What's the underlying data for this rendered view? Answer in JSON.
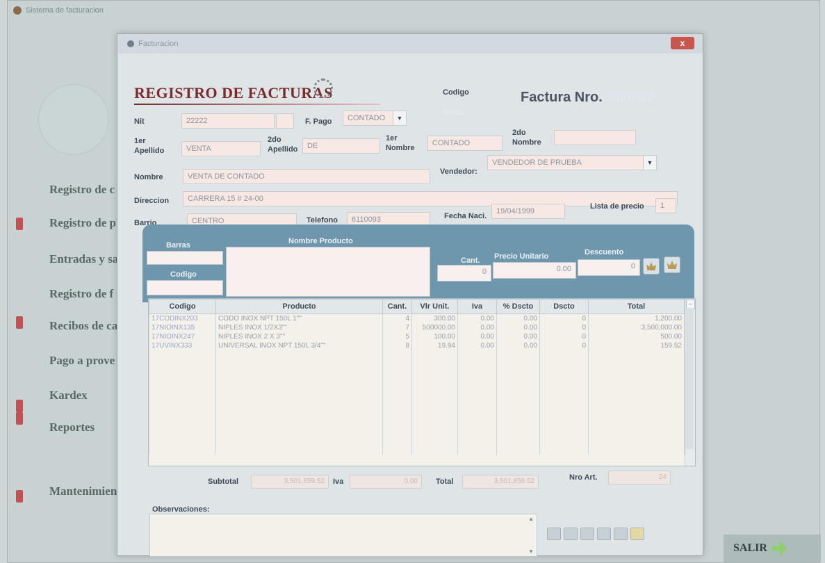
{
  "app": {
    "title": "Sistema de facturacion"
  },
  "menu": [
    {
      "label": "Registro de c"
    },
    {
      "label": "Registro de p"
    },
    {
      "label": "Entradas y sa"
    },
    {
      "label": "Registro de f"
    },
    {
      "label": "Recibos de ca"
    },
    {
      "label": "Pago a prove"
    },
    {
      "label": "Kardex"
    },
    {
      "label": "Reportes"
    },
    {
      "label": "Mantenimien"
    }
  ],
  "salir": {
    "label": "SALIR"
  },
  "dialog": {
    "title": "Facturacion",
    "close_label": "x",
    "header_title": "REGISTRO DE FACTURAS",
    "codigo_label": "Codigo",
    "codigo_value": "000002",
    "factura_label": "Factura Nro.",
    "factura_number": "000002"
  },
  "form": {
    "nit": {
      "label": "Nit",
      "value": "22222"
    },
    "fpago": {
      "label": "F. Pago",
      "value": "CONTADO"
    },
    "ape1": {
      "label1": "1er",
      "label2": "Apellido",
      "value": "VENTA"
    },
    "ape2": {
      "label1": "2do",
      "label2": "Apellido",
      "value": "DE"
    },
    "nom1": {
      "label1": "1er",
      "label2": "Nombre",
      "value": "CONTADO"
    },
    "nom2": {
      "label1": "2do",
      "label2": "Nombre",
      "value": ""
    },
    "nombre": {
      "label": "Nombre",
      "value": "VENTA DE CONTADO"
    },
    "vendedor": {
      "label": "Vendedor:",
      "value": "VENDEDOR DE PRUEBA"
    },
    "direccion": {
      "label": "Direccion",
      "value": "CARRERA 15 # 24-00"
    },
    "barrio": {
      "label": "Barrio",
      "value": "CENTRO"
    },
    "telefono": {
      "label": "Telefono",
      "value": "6110093"
    },
    "fecha": {
      "label": "Fecha Naci.",
      "value": "19/04/1999"
    },
    "lista": {
      "label": "Lista de precio",
      "value": "1"
    }
  },
  "entry": {
    "barras_label": "Barras",
    "codigo_label": "Codigo",
    "nombre_label": "Nombre Producto",
    "cant_label": "Cant.",
    "cant_value": "0",
    "precio_label": "Precio Unitario",
    "precio_value": "0.00",
    "desc_label": "Descuento",
    "desc_value": "0"
  },
  "table": {
    "headers": [
      "Codigo",
      "Producto",
      "Cant.",
      "Vlr Unit.",
      "Iva",
      "% Dscto",
      "Dscto",
      "Total"
    ],
    "rows": [
      [
        "17CODINX203",
        "CODO INOX NPT 150L 1\"\"",
        "4",
        "300.00",
        "0.00",
        "0.00",
        "0",
        "1,200.00"
      ],
      [
        "17NIOINX135",
        "NIPLES INOX 1/2X3\"\"",
        "7",
        "500000.00",
        "0.00",
        "0.00",
        "0",
        "3,500,000.00"
      ],
      [
        "17NIOINX247",
        "NIPLES INOX 2 X 3\"\"",
        "5",
        "100.00",
        "0.00",
        "0.00",
        "0",
        "500.00"
      ],
      [
        "17UVINX333",
        "UNIVERSAL INOX NPT 150L 3/4\"\"",
        "8",
        "19.94",
        "0.00",
        "0.00",
        "0",
        "159.52"
      ]
    ]
  },
  "totals": {
    "subtotal_label": "Subtotal",
    "subtotal": "3,501,859.52",
    "iva_label": "Iva",
    "iva": "0.00",
    "total_label": "Total",
    "total": "3,501,859.52",
    "nroart_label": "Nro Art.",
    "nroart": "24"
  },
  "observaciones": {
    "label": "Observaciones:"
  }
}
